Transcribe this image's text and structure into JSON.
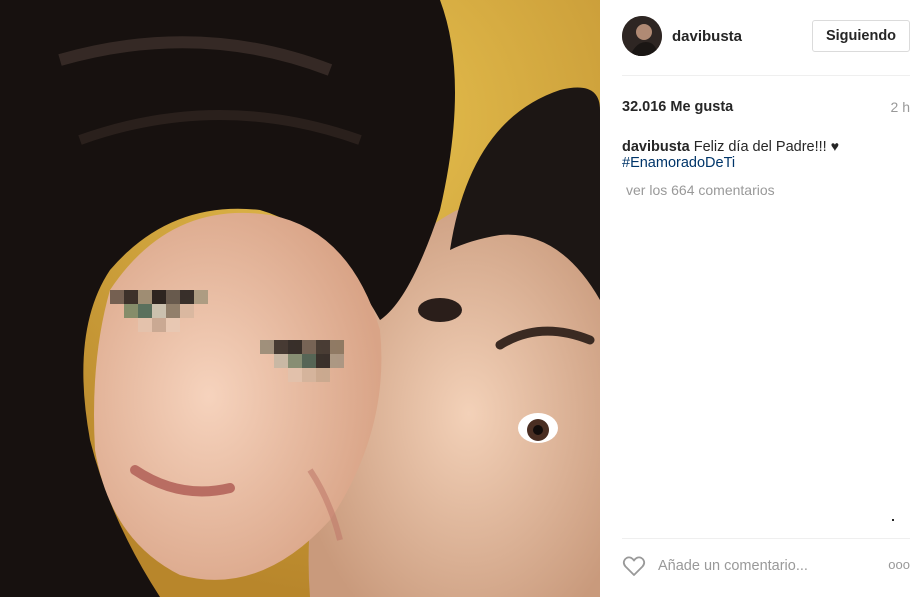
{
  "post": {
    "username": "davibusta",
    "follow_label": "Siguiendo",
    "likes": "32.016 Me gusta",
    "time_ago": "2 h",
    "caption_user": "davibusta",
    "caption_text": "Feliz día del Padre!!!",
    "caption_heart": "♥",
    "hashtag": "#EnamoradoDeTi",
    "view_comments": "ver los 664 comentarios",
    "comment_placeholder": "Añade un comentario...",
    "more_label": "ooo"
  },
  "icons": {
    "like": "heart-outline-icon",
    "more": "more-options-icon"
  },
  "colors": {
    "hashtag": "#003569",
    "muted": "#999999",
    "text": "#262626",
    "border": "#dbdbdb"
  }
}
